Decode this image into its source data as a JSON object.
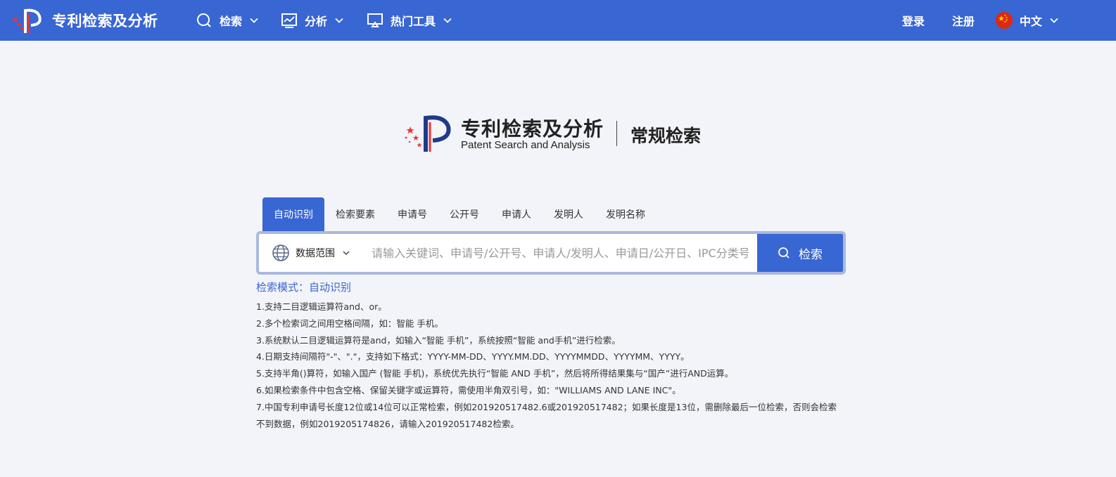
{
  "header": {
    "brand_title": "专利检索及分析",
    "nav": [
      {
        "label": "检索",
        "icon": "search-icon"
      },
      {
        "label": "分析",
        "icon": "chart-icon"
      },
      {
        "label": "热门工具",
        "icon": "monitor-icon"
      }
    ],
    "login": "登录",
    "register": "注册",
    "language": "中文",
    "language_icon": "china-flag-icon",
    "bg_color": "#3866d3"
  },
  "hero": {
    "title_cn": "专利检索及分析",
    "title_en": "Patent Search and Analysis",
    "mode": "常规检索"
  },
  "tabs": [
    {
      "label": "自动识别",
      "active": true
    },
    {
      "label": "检索要素",
      "active": false
    },
    {
      "label": "申请号",
      "active": false
    },
    {
      "label": "公开号",
      "active": false
    },
    {
      "label": "申请人",
      "active": false
    },
    {
      "label": "发明人",
      "active": false
    },
    {
      "label": "发明名称",
      "active": false
    }
  ],
  "search": {
    "scope_label": "数据范围",
    "scope_icon": "globe-icon",
    "placeholder": "请输入关键词、申请号/公开号、申请人/发明人、申请日/公开日、IPC分类号/CPC分类号",
    "value": "",
    "button_label": "检索"
  },
  "help": {
    "mode_line": "检索模式：自动识别",
    "rules": [
      "1.支持二目逻辑运算符and、or。",
      "2.多个检索词之间用空格间隔，如：智能 手机。",
      "3.系统默认二目逻辑运算符是and，如输入“智能 手机”，系统按照“智能 and手机”进行检索。",
      "4.日期支持间隔符\"-\"、\".\"，支持如下格式：YYYY-MM-DD、YYYY.MM.DD、YYYYMMDD、YYYYMM、YYYY。",
      "5.支持半角()算符，如输入国产 (智能 手机)，系统优先执行“智能 AND 手机”，然后将所得结果集与“国产”进行AND运算。",
      "6.如果检索条件中包含空格、保留关键字或运算符，需使用半角双引号，如：\"WILLIAMS AND LANE INC\"。",
      "7.中国专利申请号长度12位或14位可以正常检索，例如201920517482.6或201920517482；如果长度是13位，需删除最后一位检索，否则会检索",
      "不到数据，例如2019205174826，请输入201920517482检索。"
    ]
  }
}
